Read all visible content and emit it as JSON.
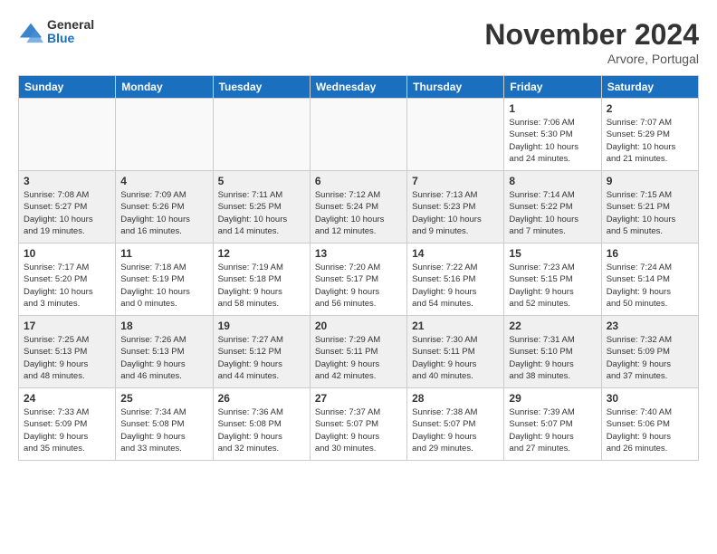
{
  "logo": {
    "general": "General",
    "blue": "Blue"
  },
  "title": "November 2024",
  "location": "Arvore, Portugal",
  "days_of_week": [
    "Sunday",
    "Monday",
    "Tuesday",
    "Wednesday",
    "Thursday",
    "Friday",
    "Saturday"
  ],
  "weeks": [
    [
      {
        "day": "",
        "info": ""
      },
      {
        "day": "",
        "info": ""
      },
      {
        "day": "",
        "info": ""
      },
      {
        "day": "",
        "info": ""
      },
      {
        "day": "",
        "info": ""
      },
      {
        "day": "1",
        "info": "Sunrise: 7:06 AM\nSunset: 5:30 PM\nDaylight: 10 hours\nand 24 minutes."
      },
      {
        "day": "2",
        "info": "Sunrise: 7:07 AM\nSunset: 5:29 PM\nDaylight: 10 hours\nand 21 minutes."
      }
    ],
    [
      {
        "day": "3",
        "info": "Sunrise: 7:08 AM\nSunset: 5:27 PM\nDaylight: 10 hours\nand 19 minutes."
      },
      {
        "day": "4",
        "info": "Sunrise: 7:09 AM\nSunset: 5:26 PM\nDaylight: 10 hours\nand 16 minutes."
      },
      {
        "day": "5",
        "info": "Sunrise: 7:11 AM\nSunset: 5:25 PM\nDaylight: 10 hours\nand 14 minutes."
      },
      {
        "day": "6",
        "info": "Sunrise: 7:12 AM\nSunset: 5:24 PM\nDaylight: 10 hours\nand 12 minutes."
      },
      {
        "day": "7",
        "info": "Sunrise: 7:13 AM\nSunset: 5:23 PM\nDaylight: 10 hours\nand 9 minutes."
      },
      {
        "day": "8",
        "info": "Sunrise: 7:14 AM\nSunset: 5:22 PM\nDaylight: 10 hours\nand 7 minutes."
      },
      {
        "day": "9",
        "info": "Sunrise: 7:15 AM\nSunset: 5:21 PM\nDaylight: 10 hours\nand 5 minutes."
      }
    ],
    [
      {
        "day": "10",
        "info": "Sunrise: 7:17 AM\nSunset: 5:20 PM\nDaylight: 10 hours\nand 3 minutes."
      },
      {
        "day": "11",
        "info": "Sunrise: 7:18 AM\nSunset: 5:19 PM\nDaylight: 10 hours\nand 0 minutes."
      },
      {
        "day": "12",
        "info": "Sunrise: 7:19 AM\nSunset: 5:18 PM\nDaylight: 9 hours\nand 58 minutes."
      },
      {
        "day": "13",
        "info": "Sunrise: 7:20 AM\nSunset: 5:17 PM\nDaylight: 9 hours\nand 56 minutes."
      },
      {
        "day": "14",
        "info": "Sunrise: 7:22 AM\nSunset: 5:16 PM\nDaylight: 9 hours\nand 54 minutes."
      },
      {
        "day": "15",
        "info": "Sunrise: 7:23 AM\nSunset: 5:15 PM\nDaylight: 9 hours\nand 52 minutes."
      },
      {
        "day": "16",
        "info": "Sunrise: 7:24 AM\nSunset: 5:14 PM\nDaylight: 9 hours\nand 50 minutes."
      }
    ],
    [
      {
        "day": "17",
        "info": "Sunrise: 7:25 AM\nSunset: 5:13 PM\nDaylight: 9 hours\nand 48 minutes."
      },
      {
        "day": "18",
        "info": "Sunrise: 7:26 AM\nSunset: 5:13 PM\nDaylight: 9 hours\nand 46 minutes."
      },
      {
        "day": "19",
        "info": "Sunrise: 7:27 AM\nSunset: 5:12 PM\nDaylight: 9 hours\nand 44 minutes."
      },
      {
        "day": "20",
        "info": "Sunrise: 7:29 AM\nSunset: 5:11 PM\nDaylight: 9 hours\nand 42 minutes."
      },
      {
        "day": "21",
        "info": "Sunrise: 7:30 AM\nSunset: 5:11 PM\nDaylight: 9 hours\nand 40 minutes."
      },
      {
        "day": "22",
        "info": "Sunrise: 7:31 AM\nSunset: 5:10 PM\nDaylight: 9 hours\nand 38 minutes."
      },
      {
        "day": "23",
        "info": "Sunrise: 7:32 AM\nSunset: 5:09 PM\nDaylight: 9 hours\nand 37 minutes."
      }
    ],
    [
      {
        "day": "24",
        "info": "Sunrise: 7:33 AM\nSunset: 5:09 PM\nDaylight: 9 hours\nand 35 minutes."
      },
      {
        "day": "25",
        "info": "Sunrise: 7:34 AM\nSunset: 5:08 PM\nDaylight: 9 hours\nand 33 minutes."
      },
      {
        "day": "26",
        "info": "Sunrise: 7:36 AM\nSunset: 5:08 PM\nDaylight: 9 hours\nand 32 minutes."
      },
      {
        "day": "27",
        "info": "Sunrise: 7:37 AM\nSunset: 5:07 PM\nDaylight: 9 hours\nand 30 minutes."
      },
      {
        "day": "28",
        "info": "Sunrise: 7:38 AM\nSunset: 5:07 PM\nDaylight: 9 hours\nand 29 minutes."
      },
      {
        "day": "29",
        "info": "Sunrise: 7:39 AM\nSunset: 5:07 PM\nDaylight: 9 hours\nand 27 minutes."
      },
      {
        "day": "30",
        "info": "Sunrise: 7:40 AM\nSunset: 5:06 PM\nDaylight: 9 hours\nand 26 minutes."
      }
    ]
  ]
}
